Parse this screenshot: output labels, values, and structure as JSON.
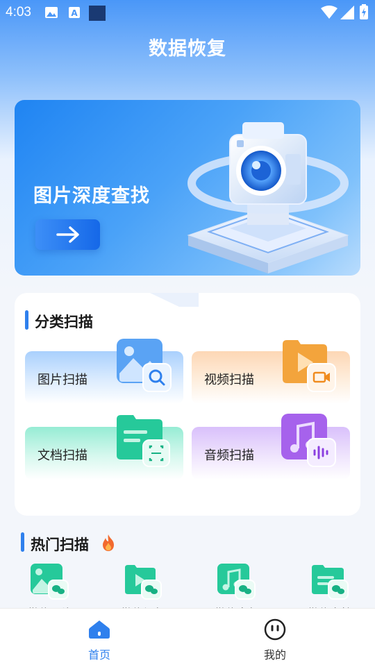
{
  "status_bar": {
    "time": "4:03",
    "icons": [
      "image-icon",
      "font-icon",
      "square-icon",
      "wifi-icon",
      "signal-icon",
      "battery-icon"
    ]
  },
  "header": {
    "title": "数据恢复"
  },
  "banner": {
    "title": "图片深度查找",
    "button_icon": "arrow-right-icon"
  },
  "categories": {
    "title": "分类扫描",
    "items": [
      {
        "label": "图片扫描",
        "icon": "image-search-icon"
      },
      {
        "label": "视频扫描",
        "icon": "video-folder-icon"
      },
      {
        "label": "文档扫描",
        "icon": "document-folder-icon"
      },
      {
        "label": "音频扫描",
        "icon": "audio-folder-icon"
      }
    ]
  },
  "hot_scan": {
    "title": "热门扫描",
    "icon": "flame-icon",
    "items": [
      {
        "label": "微信图片",
        "icon": "wechat-image-icon"
      },
      {
        "label": "微信视频",
        "icon": "wechat-video-icon"
      },
      {
        "label": "微信音频",
        "icon": "wechat-audio-icon"
      },
      {
        "label": "微信文档",
        "icon": "wechat-document-icon"
      }
    ]
  },
  "bottom_nav": {
    "items": [
      {
        "label": "首页",
        "icon": "home-icon",
        "active": true
      },
      {
        "label": "我的",
        "icon": "smiley-icon",
        "active": false
      }
    ],
    "active_color": "#2f80ed",
    "inactive_color": "#333333"
  }
}
